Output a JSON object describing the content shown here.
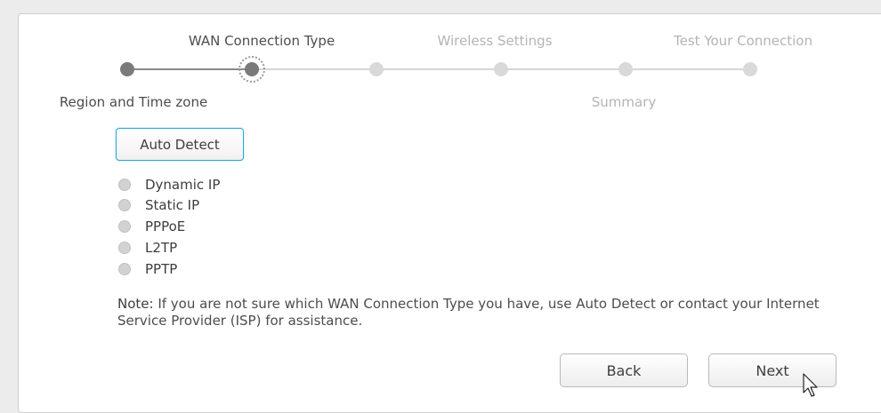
{
  "wizard": {
    "steps_top": [
      {
        "label": "WAN Connection Type",
        "state": "active"
      },
      {
        "label": "Wireless Settings",
        "state": "inactive"
      },
      {
        "label": "Test Your Connection",
        "state": "inactive"
      }
    ],
    "steps_bottom": [
      {
        "label": "Region and Time zone",
        "state": "active"
      },
      {
        "label": "Summary",
        "state": "inactive"
      }
    ],
    "current_step": 2,
    "total_steps": 6
  },
  "auto_detect_label": "Auto Detect",
  "connection_types": [
    {
      "label": "Dynamic IP",
      "selected": false
    },
    {
      "label": "Static IP",
      "selected": false
    },
    {
      "label": "PPPoE",
      "selected": false
    },
    {
      "label": "L2TP",
      "selected": false
    },
    {
      "label": "PPTP",
      "selected": false
    }
  ],
  "note": {
    "prefix": "Note:",
    "text": " If you are not sure which WAN Connection Type you have, use Auto Detect or contact your Internet Service Provider (ISP) for assistance."
  },
  "buttons": {
    "back": "Back",
    "next": "Next"
  },
  "colors": {
    "accent": "#2ca7d6",
    "step_done": "#7a7a7a",
    "step_pending": "#d9d9d9",
    "text_inactive": "#b4b4b4"
  },
  "icons": {
    "cursor": "pointer-arrow-icon"
  }
}
